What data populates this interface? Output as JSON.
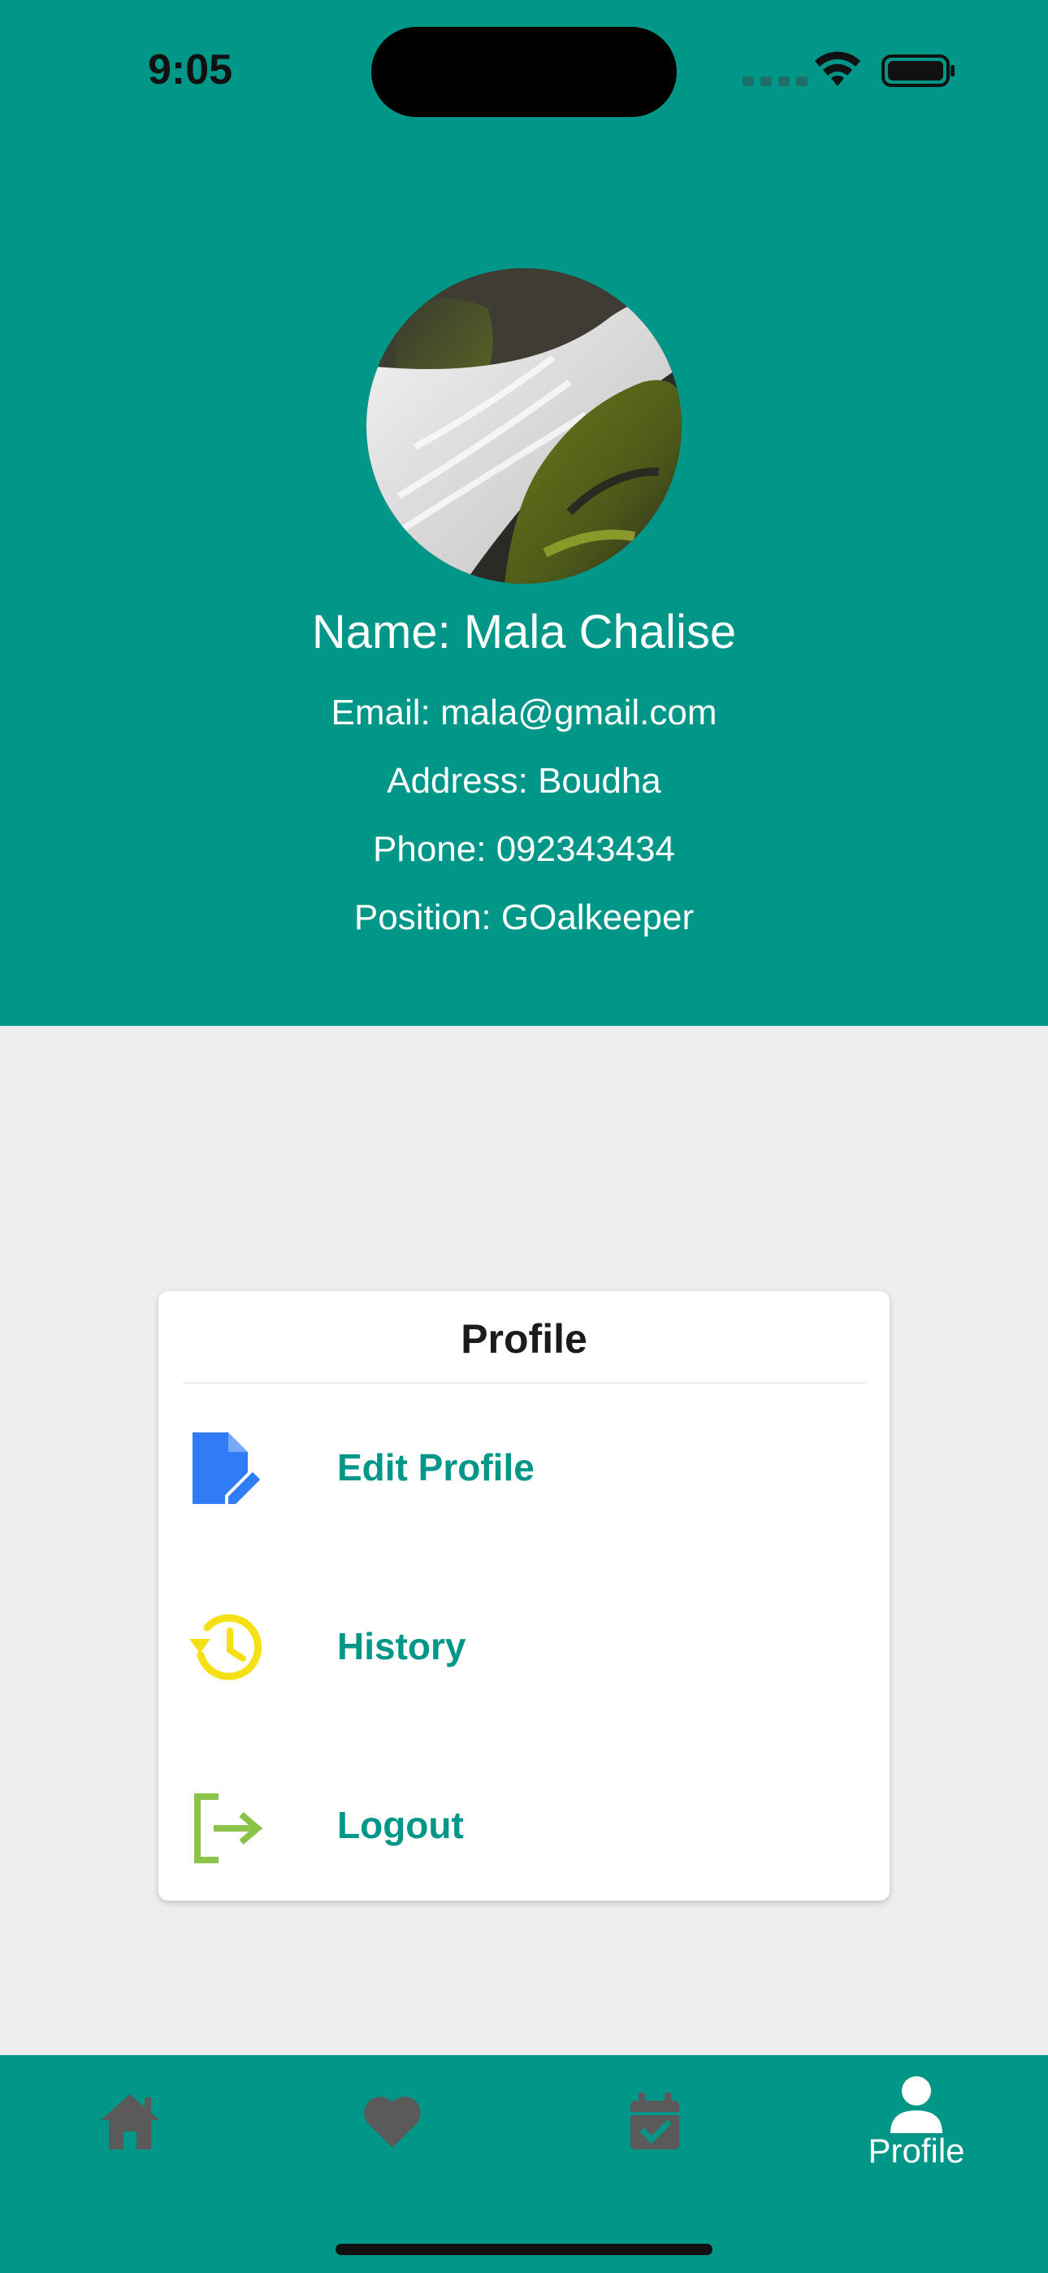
{
  "status_bar": {
    "time": "9:05"
  },
  "profile": {
    "name": "Name: Mala Chalise",
    "email": "Email: mala@gmail.com",
    "address": "Address: Boudha",
    "phone": "Phone: 092343434",
    "position": "Position: GOalkeeper"
  },
  "card": {
    "title": "Profile",
    "items": [
      {
        "label": "Edit Profile",
        "icon": "edit-document-icon",
        "color": "#2f7cf6"
      },
      {
        "label": "History",
        "icon": "history-icon",
        "color": "#f5e016"
      },
      {
        "label": "Logout",
        "icon": "logout-icon",
        "color": "#8bc34a"
      }
    ]
  },
  "bottom_nav": {
    "items": [
      {
        "icon": "home-icon",
        "label": ""
      },
      {
        "icon": "heart-icon",
        "label": ""
      },
      {
        "icon": "calendar-check-icon",
        "label": ""
      },
      {
        "icon": "person-icon",
        "label": "Profile",
        "active": true
      }
    ]
  },
  "colors": {
    "primary": "#009688",
    "background": "#eeeeee",
    "inactive_nav": "#5a5a5a",
    "active_nav": "#ffffff"
  }
}
